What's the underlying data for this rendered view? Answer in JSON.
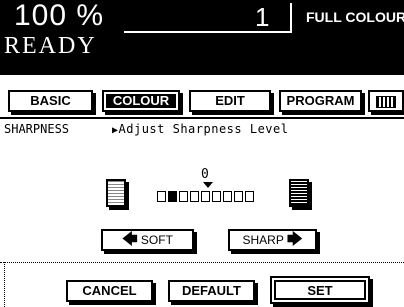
{
  "status": {
    "zoom": "100  %",
    "copies": "1",
    "colour_mode": "FULL COLOUR",
    "state": "READY"
  },
  "tabs": [
    {
      "label": "BASIC"
    },
    {
      "label": "COLOUR"
    },
    {
      "label": "EDIT"
    },
    {
      "label": "PROGRAM"
    }
  ],
  "panel": {
    "name": "SHARPNESS",
    "instruction": "Adjust Sharpness Level",
    "level_value": "0"
  },
  "scale": {
    "steps": 9,
    "selected_index": 1
  },
  "buttons": {
    "soft": "SOFT",
    "sharp": "SHARP",
    "cancel": "CANCEL",
    "default": "DEFAULT",
    "set": "SET"
  }
}
